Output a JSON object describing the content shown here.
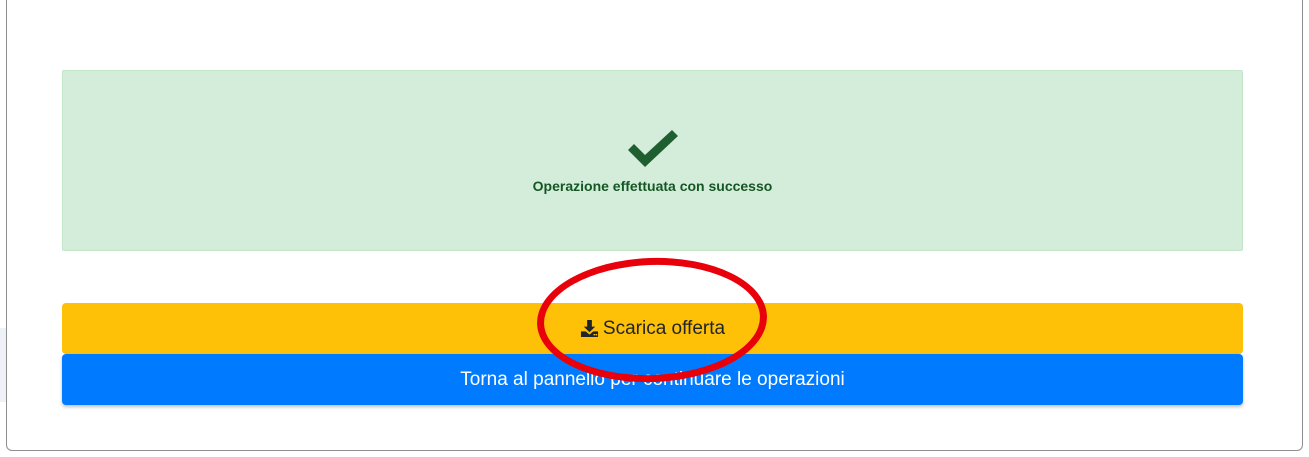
{
  "alert": {
    "icon": "check-icon",
    "message": "Operazione effettuata con successo",
    "color": "#155724",
    "background": "#d4edda"
  },
  "buttons": {
    "download": {
      "icon": "download-icon",
      "label": "Scarica offerta",
      "color": "#ffc107"
    },
    "back": {
      "label": "Torna al pannello per continuare le operazioni",
      "color": "#007bff"
    }
  },
  "annotation": {
    "shape": "ellipse",
    "color": "#e8000a"
  }
}
